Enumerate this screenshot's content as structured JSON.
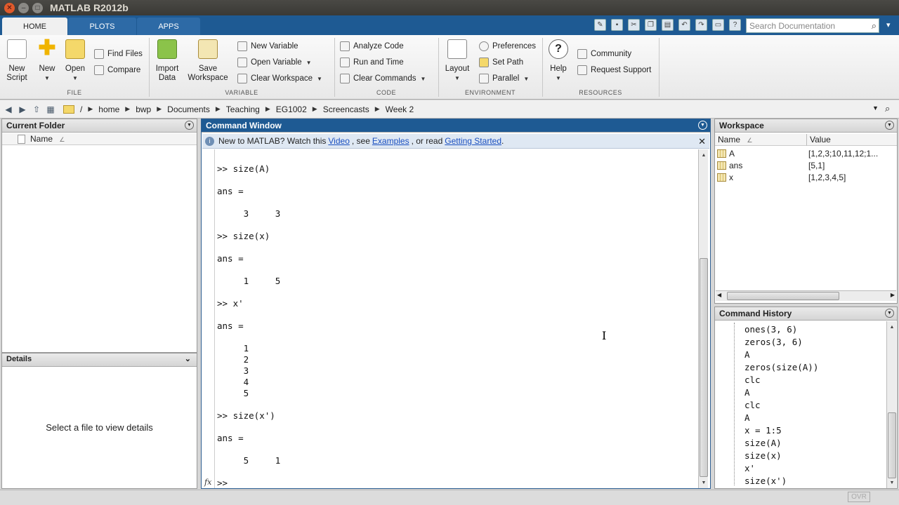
{
  "window": {
    "title": "MATLAB R2012b"
  },
  "tabs": [
    {
      "label": "HOME",
      "active": true
    },
    {
      "label": "PLOTS",
      "active": false
    },
    {
      "label": "APPS",
      "active": false
    }
  ],
  "search": {
    "placeholder": "Search Documentation"
  },
  "ribbon": {
    "file": {
      "label": "FILE",
      "new_script": "New Script",
      "new": "New",
      "open": "Open",
      "find_files": "Find Files",
      "compare": "Compare"
    },
    "variable": {
      "label": "VARIABLE",
      "import_data": "Import Data",
      "save_workspace": "Save Workspace",
      "new_variable": "New Variable",
      "open_variable": "Open Variable",
      "clear_workspace": "Clear Workspace"
    },
    "code": {
      "label": "CODE",
      "analyze_code": "Analyze Code",
      "run_and_time": "Run and Time",
      "clear_commands": "Clear Commands"
    },
    "environment": {
      "label": "ENVIRONMENT",
      "layout": "Layout",
      "preferences": "Preferences",
      "set_path": "Set Path",
      "parallel": "Parallel"
    },
    "resources": {
      "label": "RESOURCES",
      "help": "Help",
      "community": "Community",
      "request_support": "Request Support"
    }
  },
  "address": {
    "root": "/",
    "crumbs": [
      "home",
      "bwp",
      "Documents",
      "Teaching",
      "EG1002",
      "Screencasts",
      "Week 2"
    ]
  },
  "current_folder": {
    "title": "Current Folder",
    "name_col": "Name",
    "details_title": "Details",
    "details_msg": "Select a file to view details"
  },
  "command_window": {
    "title": "Command Window",
    "info_prefix": "New to MATLAB? Watch this",
    "info_video": "Video",
    "info_see": ", see",
    "info_examples": "Examples",
    "info_read": ", or read",
    "info_getting_started": "Getting Started",
    "info_end": ".",
    "lines": [
      ">> size(A)",
      "ans =",
      "     3     3",
      ">> size(x)",
      "ans =",
      "     1     5",
      ">> x'",
      "ans =",
      "     1",
      "     2",
      "     3",
      "     4",
      "     5",
      ">> size(x')",
      "ans =",
      "     5     1"
    ],
    "fx": "fx",
    "prompt": ">>"
  },
  "workspace": {
    "title": "Workspace",
    "col_name": "Name",
    "col_value": "Value",
    "rows": [
      {
        "name": "A",
        "value": "[1,2,3;10,11,12;1..."
      },
      {
        "name": "ans",
        "value": "[5,1]"
      },
      {
        "name": "x",
        "value": "[1,2,3,4,5]"
      }
    ]
  },
  "history": {
    "title": "Command History",
    "items": [
      "ones(3, 6)",
      "zeros(3, 6)",
      "A",
      "zeros(size(A))",
      "clc",
      "A",
      "clc",
      "A",
      "x = 1:5",
      "size(A)",
      "size(x)",
      "x'",
      "size(x')"
    ]
  },
  "status": {
    "ovr": "OVR"
  }
}
